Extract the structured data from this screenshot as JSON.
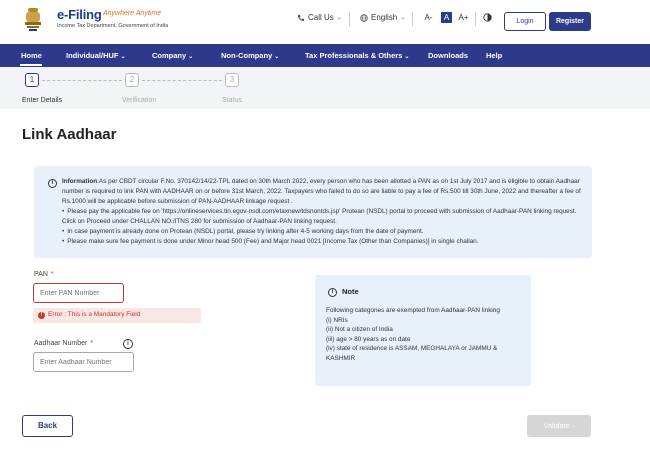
{
  "header": {
    "logo_title": "e-Filing",
    "logo_tagline": "Anywhere Anytime",
    "logo_subtitle": "Income Tax Department, Government of India",
    "call_us": "Call Us",
    "language": "English",
    "font_decrease": "A-",
    "font_normal": "A",
    "font_increase": "A+",
    "login": "Login",
    "register": "Register"
  },
  "nav": {
    "items": [
      {
        "label": "Home"
      },
      {
        "label": "Individual/HUF"
      },
      {
        "label": "Company"
      },
      {
        "label": "Non-Company"
      },
      {
        "label": "Tax Professionals & Others"
      },
      {
        "label": "Downloads"
      },
      {
        "label": "Help"
      }
    ]
  },
  "stepper": {
    "steps": [
      {
        "number": "1",
        "label": "Enter Details"
      },
      {
        "number": "2",
        "label": "Verification"
      },
      {
        "number": "3",
        "label": "Status"
      }
    ]
  },
  "page_title": "Link Aadhaar",
  "info": {
    "label": "Information",
    "text": ":As per CBDT circular F.No. 370142/14/22-TPL dated on 30th March 2022, every person who has been allotted a PAN as on 1st July 2017 and is eligible to obtain Aadhaar number is required to link PAN with AADHAAR on or before 31st March, 2022. Taxpayers who failed to do so are liable to pay a fee of Rs.500 till 30th June, 2022 and thereafter a fee of Rs.1000 will be applicable before submission of PAN-AADHAAR linkage request .",
    "bullets": [
      "Please pay the applicable fee on 'https://onlineservices.tin.egov-nsdl.com/etaxnew/tdsnontds.jsp' Protean (NSDL) portal to proceed with submission of Aadhaar-PAN linking request. Click on Proceed under CHALLAN NO./ITNS 280 for submission of Aadhaar-PAN linking request.",
      "In case payment is already done on Protean (NSDL) portal, please try linking after 4-5 working days from the date of payment.",
      "Please make sure fee payment is done under Minor head 500 (Fee) and Major head 0021 [Income Tax (Other than Companies)] in single challan."
    ]
  },
  "form": {
    "pan_label": "PAN",
    "pan_required": "*",
    "pan_placeholder": "Enter PAN Number",
    "pan_value": "",
    "error_text": "Error : This is a Mandatory Field",
    "aadhaar_label": "Aadhaar Number",
    "aadhaar_required": "*",
    "aadhaar_placeholder": "Enter Aadhaar Number",
    "aadhaar_value": ""
  },
  "note": {
    "title": "Note",
    "lines": [
      "Following categories are exempted from Aadhaar-PAN linking",
      "(i) NRIs",
      "(ii) Not a citizen of India",
      "(iii) age > 80 years as on date",
      "(iv) state of residence is ASSAM, MEGHALAYA or JAMMU & KASHMIR"
    ]
  },
  "actions": {
    "back": "Back",
    "validate": "Validate"
  },
  "colors": {
    "brand": "#2d3a8c",
    "error": "#c0392b",
    "info_bg": "#e8f0fa",
    "disabled": "#d6d6d6"
  }
}
